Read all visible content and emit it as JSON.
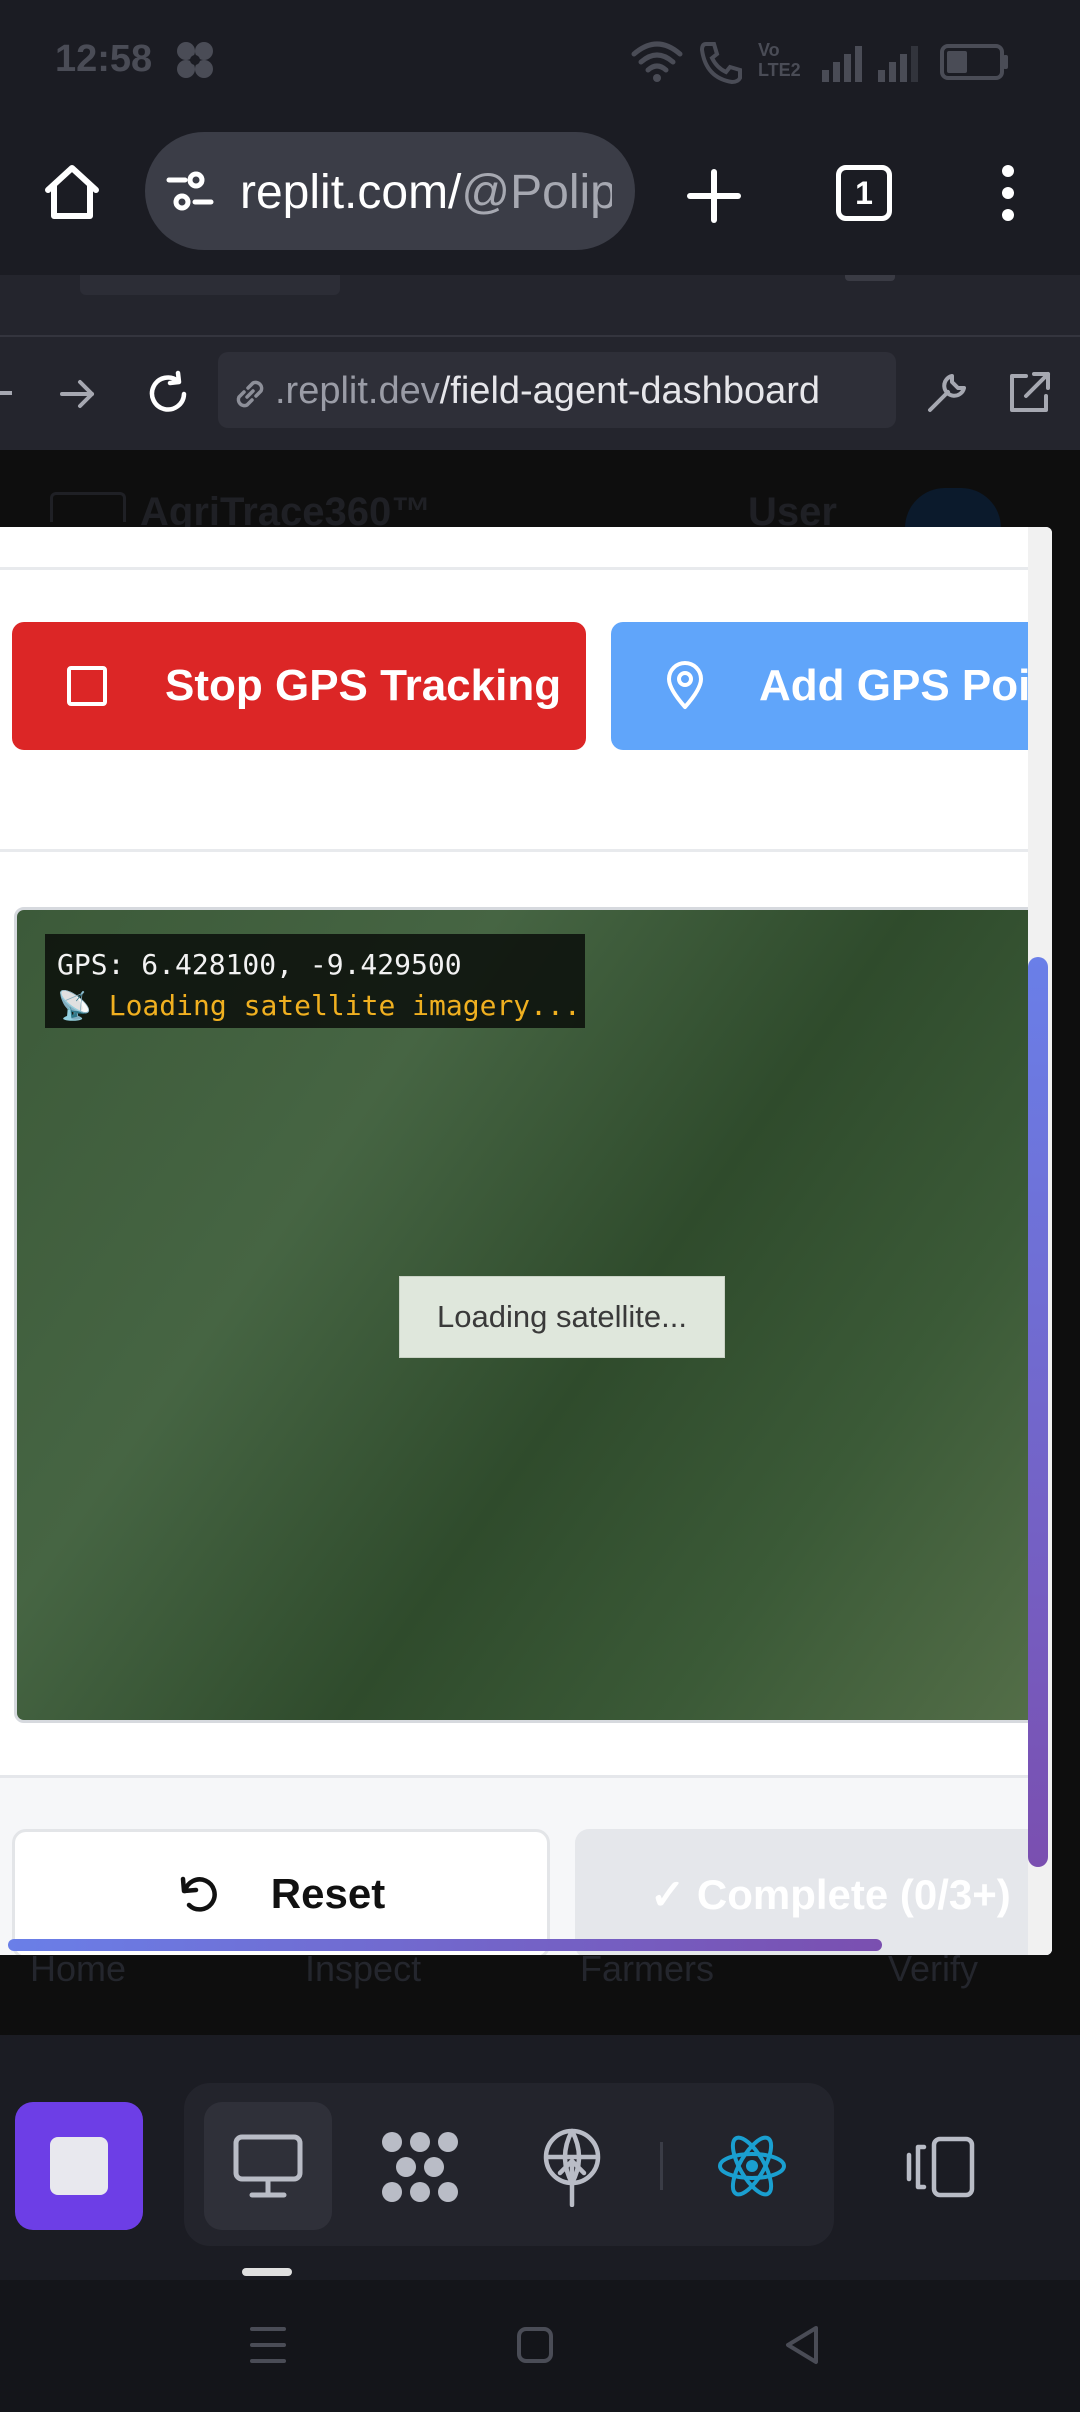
{
  "status_bar": {
    "time": "12:58",
    "network_label_top": "Vo",
    "network_label_bottom": "LTE2"
  },
  "browser": {
    "url_host": "replit.com/",
    "url_path": "@Polip",
    "tab_count": "1"
  },
  "webview": {
    "url_domain": ".replit.dev",
    "url_path": "/field-agent-dashboard"
  },
  "page_behind": {
    "app_name": "AgriTrace360™",
    "user_label": "User"
  },
  "modal": {
    "stop_gps_label": "Stop GPS Tracking",
    "add_gps_label": "Add GPS Poir",
    "map": {
      "gps_line": "GPS: 6.428100, -9.429500",
      "loading_line": "📡 Loading satellite imagery...",
      "loading_box": "Loading satellite..."
    },
    "reset_label": "Reset",
    "complete_label": "✓ Complete (0/3+)"
  },
  "bottom_nav_ghost": [
    "Home",
    "Inspect",
    "Farmers",
    "Verify"
  ],
  "colors": {
    "stop_red": "#dc2626",
    "add_blue": "#60a5fa",
    "replit_purple": "#6d3ee6",
    "react_cyan": "#1a9fd0"
  }
}
